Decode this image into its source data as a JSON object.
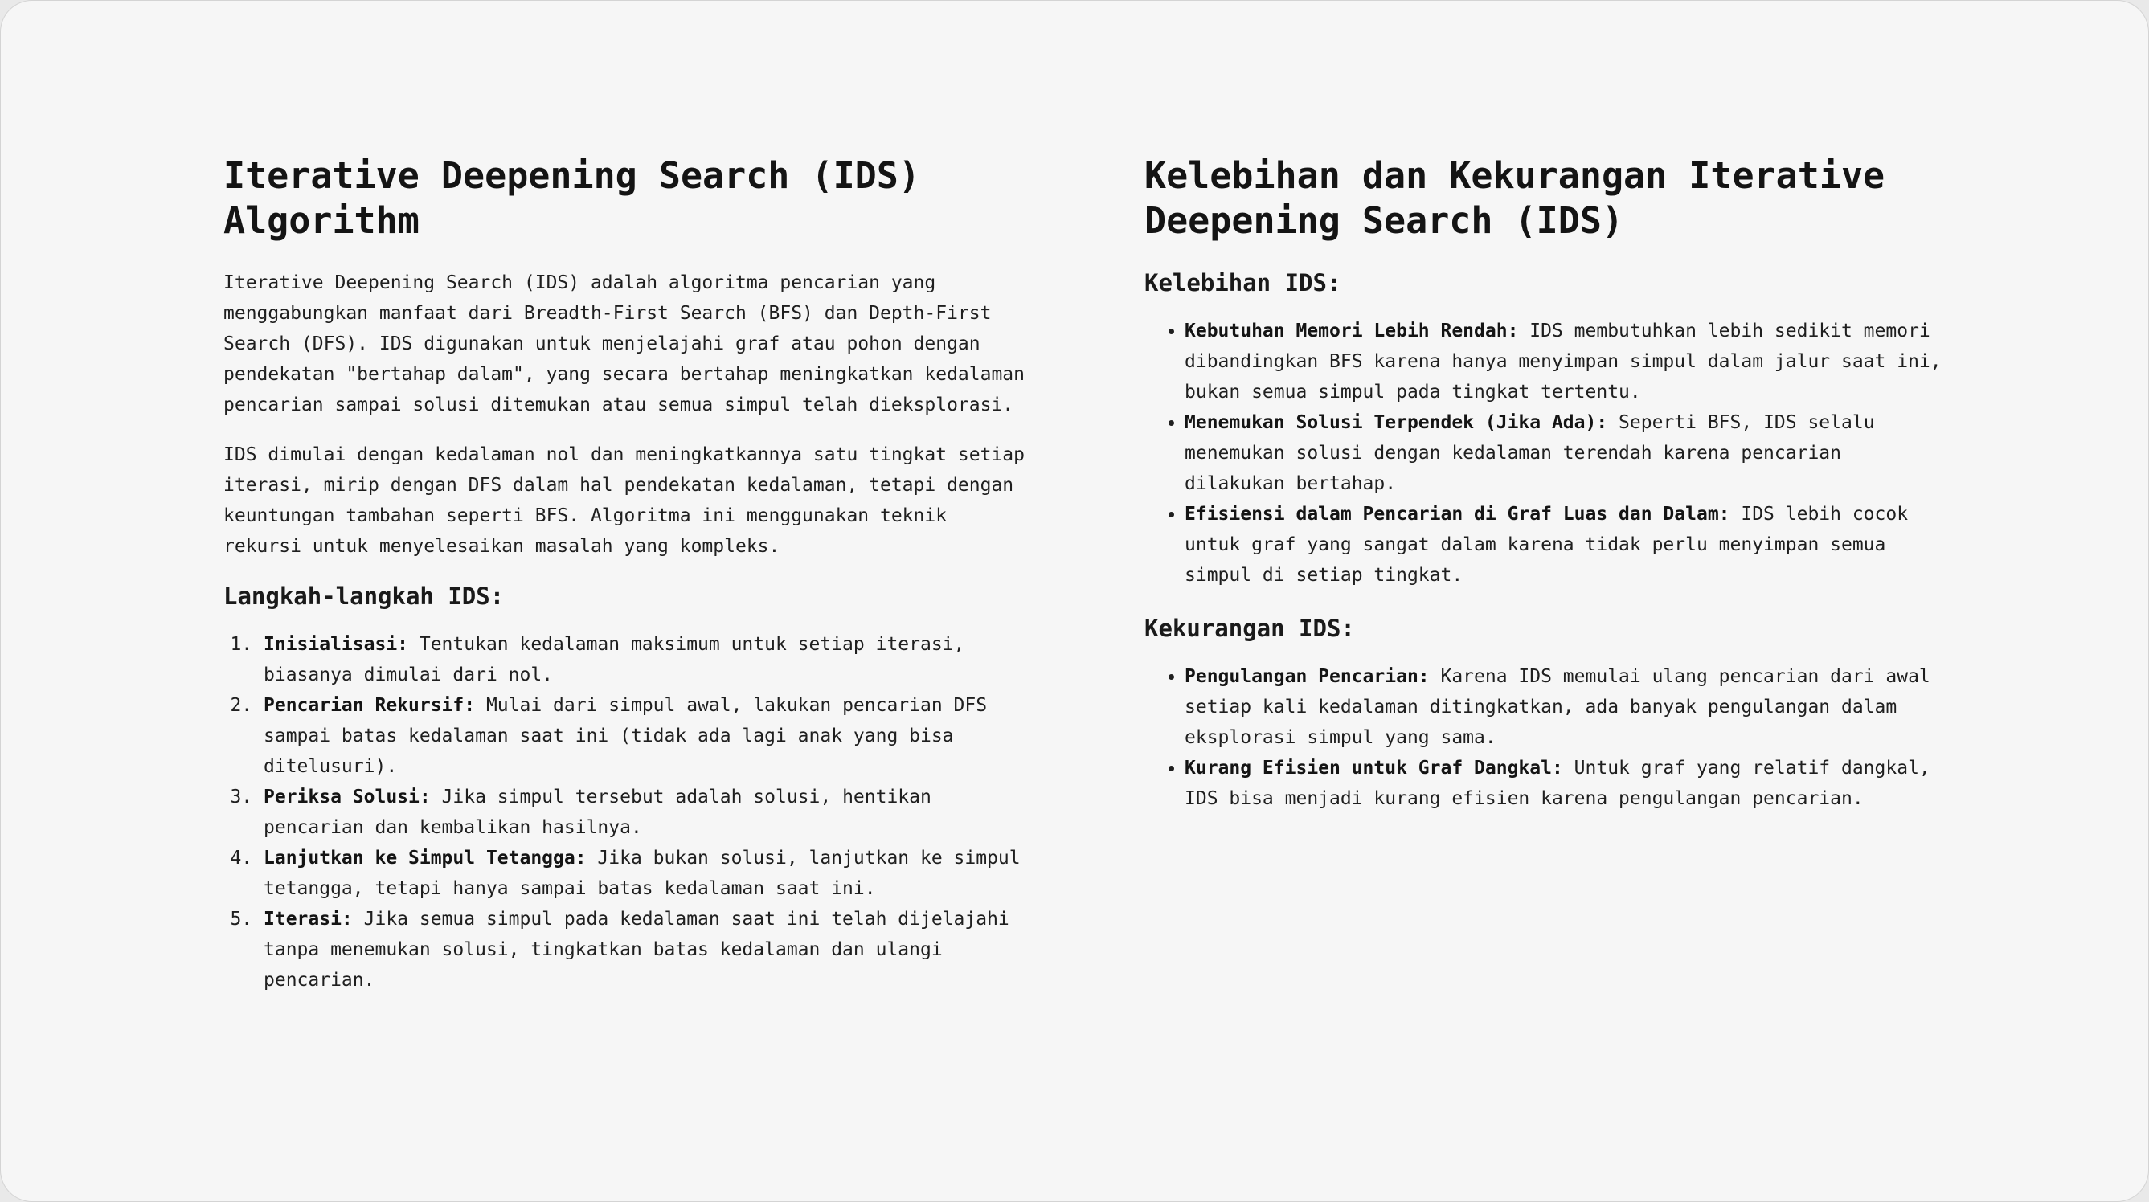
{
  "left": {
    "title": "Iterative Deepening Search (IDS) Algorithm",
    "paragraphs": [
      "Iterative Deepening Search (IDS) adalah algoritma pencarian yang menggabungkan manfaat dari Breadth-First Search (BFS) dan Depth-First Search (DFS). IDS digunakan untuk menjelajahi graf atau pohon dengan pendekatan \"bertahap dalam\", yang secara bertahap meningkatkan kedalaman pencarian sampai solusi ditemukan atau semua simpul telah dieksplorasi.",
      "IDS dimulai dengan kedalaman nol dan meningkatkannya satu tingkat setiap iterasi, mirip dengan DFS dalam hal pendekatan kedalaman, tetapi dengan keuntungan tambahan seperti BFS. Algoritma ini menggunakan teknik rekursi untuk menyelesaikan masalah yang kompleks."
    ],
    "steps_heading": "Langkah-langkah IDS:",
    "steps": [
      {
        "term": "Inisialisasi:",
        "text": " Tentukan kedalaman maksimum untuk setiap iterasi, biasanya dimulai dari nol."
      },
      {
        "term": "Pencarian Rekursif:",
        "text": " Mulai dari simpul awal, lakukan pencarian DFS sampai batas kedalaman saat ini (tidak ada lagi anak yang bisa ditelusuri)."
      },
      {
        "term": "Periksa Solusi:",
        "text": " Jika simpul tersebut adalah solusi, hentikan pencarian dan kembalikan hasilnya."
      },
      {
        "term": "Lanjutkan ke Simpul Tetangga:",
        "text": " Jika bukan solusi, lanjutkan ke simpul tetangga, tetapi hanya sampai batas kedalaman saat ini."
      },
      {
        "term": "Iterasi:",
        "text": " Jika semua simpul pada kedalaman saat ini telah dijelajahi tanpa menemukan solusi, tingkatkan batas kedalaman dan ulangi pencarian."
      }
    ]
  },
  "right": {
    "title": "Kelebihan dan Kekurangan Iterative Deepening Search (IDS)",
    "advantages_heading": "Kelebihan IDS:",
    "advantages": [
      {
        "term": "Kebutuhan Memori Lebih Rendah:",
        "text": " IDS membutuhkan lebih sedikit memori dibandingkan BFS karena hanya menyimpan simpul dalam jalur saat ini, bukan semua simpul pada tingkat tertentu."
      },
      {
        "term": "Menemukan Solusi Terpendek (Jika Ada):",
        "text": " Seperti BFS, IDS selalu menemukan solusi dengan kedalaman terendah karena pencarian dilakukan bertahap."
      },
      {
        "term": "Efisiensi dalam Pencarian di Graf Luas dan Dalam:",
        "text": " IDS lebih cocok untuk graf yang sangat dalam karena tidak perlu menyimpan semua simpul di setiap tingkat."
      }
    ],
    "disadvantages_heading": "Kekurangan IDS:",
    "disadvantages": [
      {
        "term": "Pengulangan Pencarian:",
        "text": " Karena IDS memulai ulang pencarian dari awal setiap kali kedalaman ditingkatkan, ada banyak pengulangan dalam eksplorasi simpul yang sama."
      },
      {
        "term": "Kurang Efisien untuk Graf Dangkal:",
        "text": " Untuk graf yang relatif dangkal, IDS bisa menjadi kurang efisien karena pengulangan pencarian."
      }
    ]
  }
}
